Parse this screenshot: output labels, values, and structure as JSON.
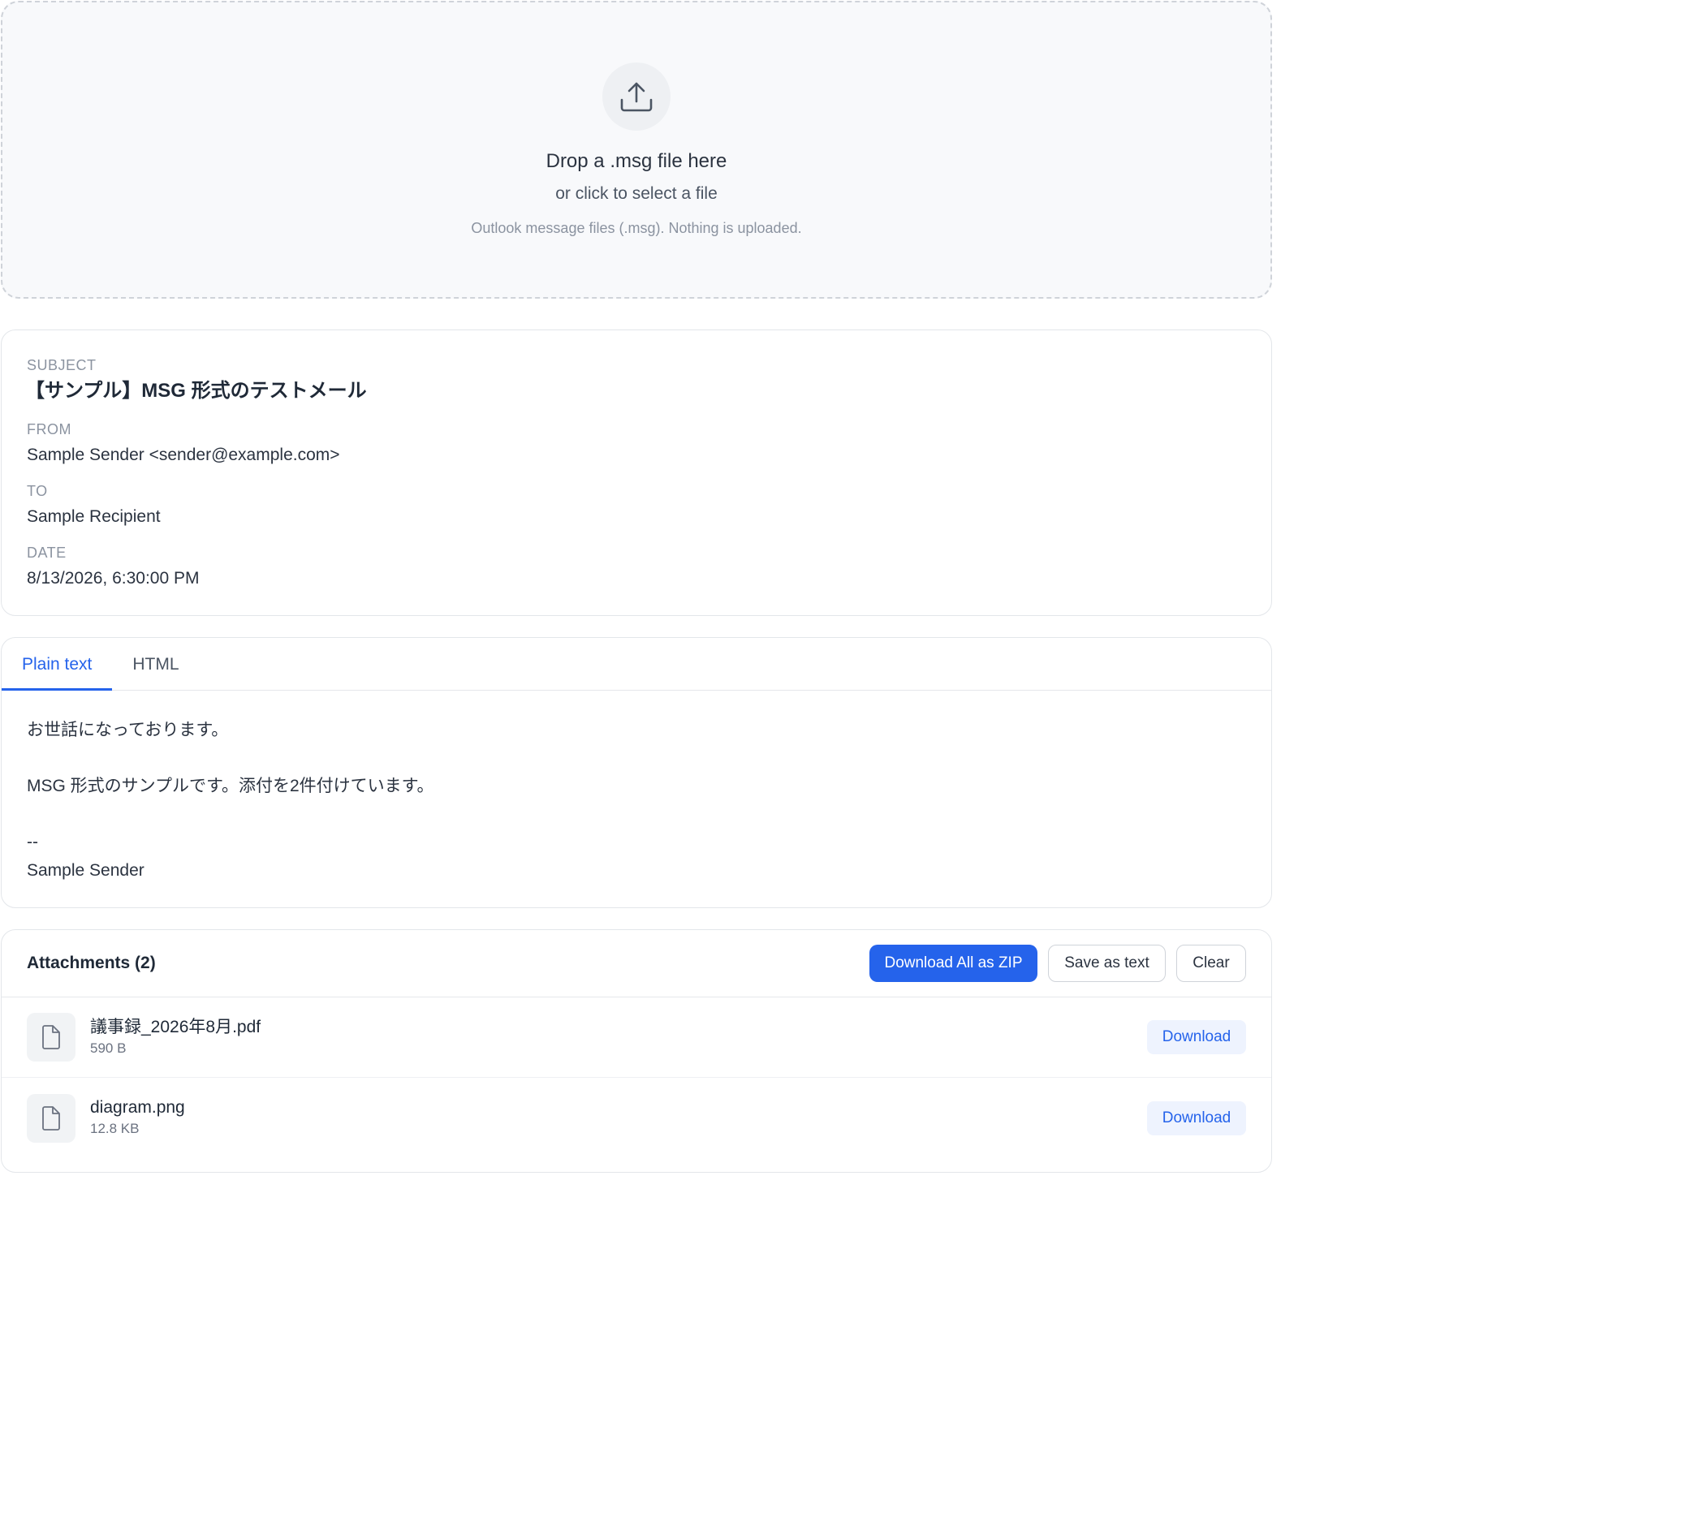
{
  "dropzone": {
    "title": "Drop a .msg file here",
    "subtitle": "or click to select a file",
    "note": "Outlook message files (.msg). Nothing is uploaded."
  },
  "meta": {
    "subject_label": "SUBJECT",
    "subject": "【サンプル】MSG 形式のテストメール",
    "from_label": "FROM",
    "from": "Sample Sender <sender@example.com>",
    "to_label": "TO",
    "to": "Sample Recipient",
    "date_label": "DATE",
    "date": "8/13/2026, 6:30:00 PM"
  },
  "tabs": [
    {
      "label": "Plain text",
      "active": true
    },
    {
      "label": "HTML",
      "active": false
    }
  ],
  "body_lines": [
    "お世話になっております。",
    "",
    "MSG 形式のサンプルです。添付を2件付けています。",
    "",
    "--",
    "Sample Sender"
  ],
  "attachments": {
    "title": "Attachments (2)",
    "download_all_label": "Download All as ZIP",
    "save_text_label": "Save as text",
    "clear_label": "Clear",
    "items": [
      {
        "name": "議事録_2026年8月.pdf",
        "size": "590 B",
        "download_label": "Download",
        "icon": "file-icon"
      },
      {
        "name": "diagram.png",
        "size": "12.8 KB",
        "download_label": "Download",
        "icon": "file-icon"
      }
    ]
  },
  "colors": {
    "accent": "#2563eb",
    "border": "#e3e6ea",
    "dropzone_bg": "#f8f9fb"
  }
}
